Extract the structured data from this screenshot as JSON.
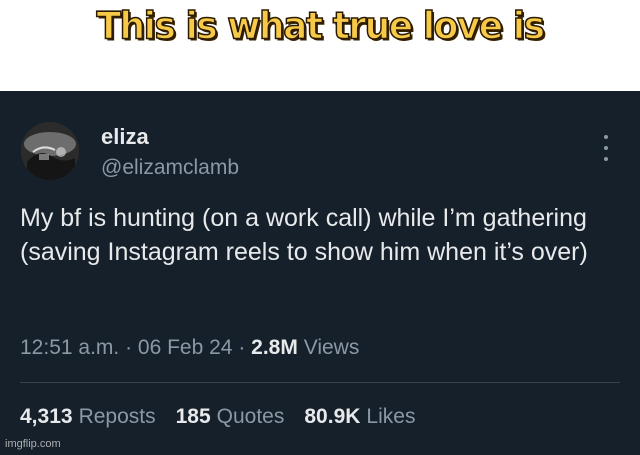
{
  "meme": {
    "caption": "This is what true love is"
  },
  "tweet": {
    "author": {
      "name": "eliza",
      "handle": "@elizamclamb"
    },
    "text": "My bf is hunting (on a work call) while I’m gathering (saving Instagram reels to show him when it’s over)",
    "time": "12:51 a.m.",
    "date": "06 Feb 24",
    "views_count": "2.8M",
    "views_label": "Views",
    "stats": {
      "reposts_count": "4,313",
      "reposts_label": "Reposts",
      "quotes_count": "185",
      "quotes_label": "Quotes",
      "likes_count": "80.9K",
      "likes_label": "Likes"
    }
  },
  "watermark": "imgflip.com",
  "colors": {
    "tweet_background": "#15202b",
    "primary_text": "#e7e9ea",
    "secondary_text": "#8b98a5",
    "caption_fill": "#f7c948"
  }
}
